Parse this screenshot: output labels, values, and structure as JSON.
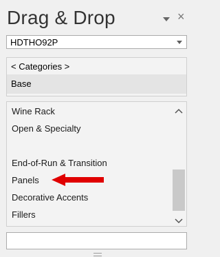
{
  "window": {
    "title": "Drag & Drop",
    "pin_icon": "pin-dropdown-icon",
    "close_icon": "close-icon",
    "close_glyph": "×"
  },
  "catalog_select": {
    "value": "HDTHO92P",
    "icon": "chevron-down-icon"
  },
  "categories": {
    "header": "< Categories >",
    "selected": "Base"
  },
  "items": [
    "Wine Rack",
    "Open & Specialty",
    "",
    "End-of-Run & Transition",
    "Panels",
    "Decorative Accents",
    "Fillers"
  ],
  "annotation": {
    "arrow_color": "#e00000",
    "points_to": "Panels"
  },
  "search": {
    "value": ""
  }
}
